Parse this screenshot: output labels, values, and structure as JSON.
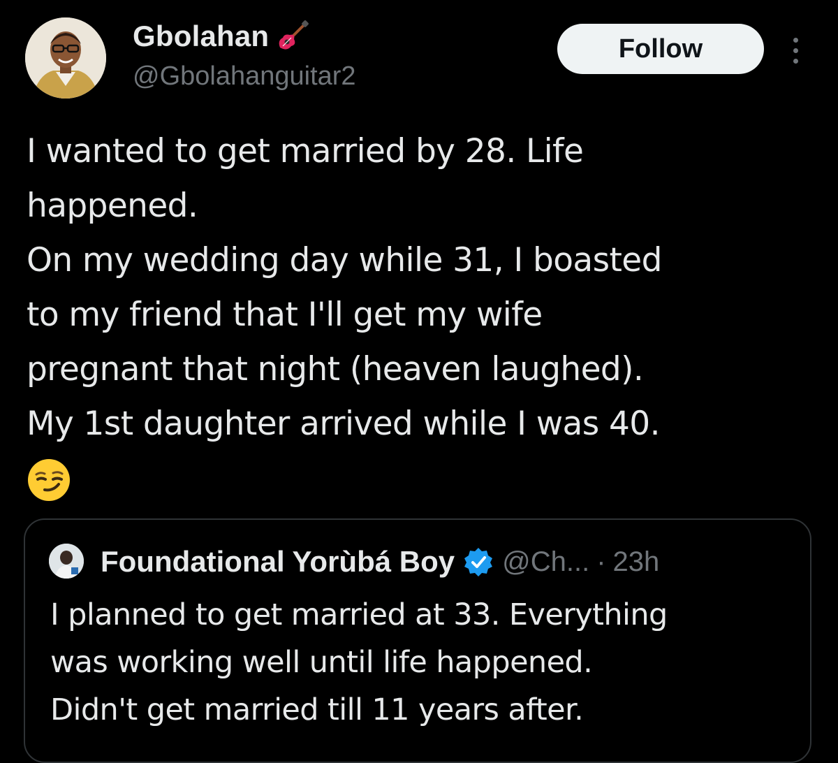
{
  "author": {
    "display_name": "Gbolahan",
    "handle": "@Gbolahanguitar2",
    "name_emoji": "guitar-icon"
  },
  "actions": {
    "follow_label": "Follow",
    "more_icon": "more-icon"
  },
  "tweet": {
    "lines": [
      "I wanted to get married by 28. Life",
      "happened.",
      "On my wedding day while 31, I boasted",
      "to my friend that I'll get my wife",
      "pregnant that night (heaven laughed).",
      "My 1st daughter arrived while I was 40."
    ],
    "emoji": "smirking-face-icon"
  },
  "quoted_tweet": {
    "display_name": "Foundational Yorùbá Boy",
    "verified": true,
    "handle": "@Ch...",
    "separator": "·",
    "time": "23h",
    "lines": [
      "I planned to get married at 33. Everything",
      "was working well until life happened.",
      "Didn't get married till 11 years after."
    ]
  },
  "colors": {
    "background": "#000000",
    "text": "#e7e9ea",
    "muted": "#71767b",
    "border": "#2f3336",
    "verified": "#1d9bf0",
    "follow_bg": "#eff3f4"
  }
}
